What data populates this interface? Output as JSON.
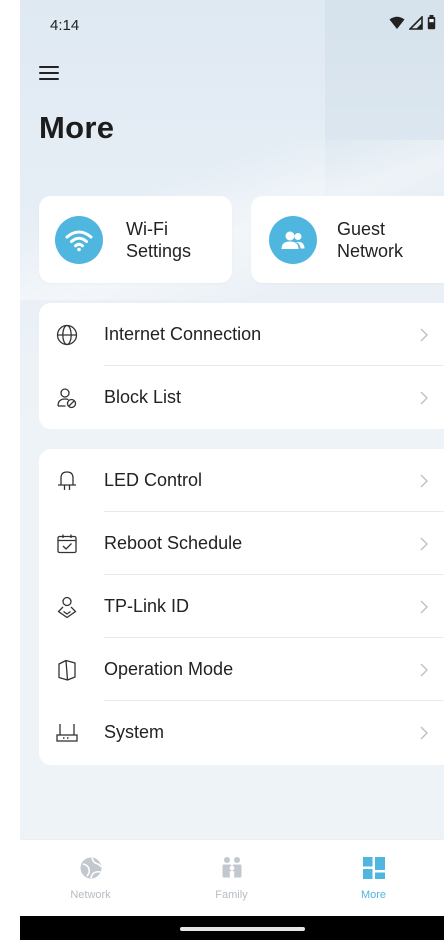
{
  "status_bar": {
    "time": "4:14"
  },
  "header": {
    "menu_icon": "hamburger-menu-icon",
    "title": "More"
  },
  "quick_cards": [
    {
      "icon": "wifi-icon",
      "label": "Wi-Fi\nSettings"
    },
    {
      "icon": "guest-users-icon",
      "label": "Guest\nNetwork"
    }
  ],
  "list_group_1": [
    {
      "icon": "globe-icon",
      "label": "Internet Connection"
    },
    {
      "icon": "block-user-icon",
      "label": "Block List"
    }
  ],
  "list_group_2": [
    {
      "icon": "led-lamp-icon",
      "label": "LED Control"
    },
    {
      "icon": "calendar-check-icon",
      "label": "Reboot Schedule"
    },
    {
      "icon": "tplink-id-icon",
      "label": "TP-Link ID"
    },
    {
      "icon": "map-mode-icon",
      "label": "Operation Mode"
    },
    {
      "icon": "system-router-icon",
      "label": "System"
    }
  ],
  "tab_bar": {
    "tabs": [
      {
        "icon": "network-globe-icon",
        "label": "Network",
        "active": false
      },
      {
        "icon": "family-icon",
        "label": "Family",
        "active": false
      },
      {
        "icon": "more-grid-icon",
        "label": "More",
        "active": true
      }
    ]
  },
  "colors": {
    "accent": "#4fb6e0",
    "tab_inactive": "#b5bcc3",
    "background": "#eef3f7",
    "card": "#ffffff",
    "text": "#222222"
  }
}
